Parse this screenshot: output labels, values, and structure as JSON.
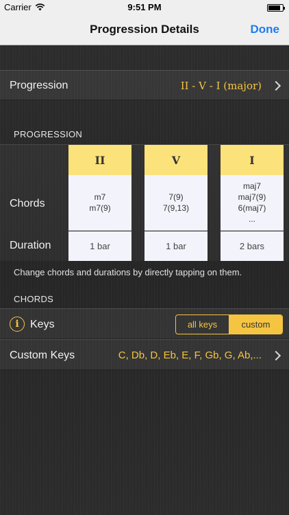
{
  "status_bar": {
    "carrier": "Carrier",
    "time": "9:51 PM",
    "battery_level": 0.85
  },
  "nav": {
    "title": "Progression Details",
    "done_label": "Done"
  },
  "progression_row": {
    "label": "Progression",
    "value": "II - V - I  (major)"
  },
  "progression_section": {
    "header": "PROGRESSION",
    "chords_label": "Chords",
    "duration_label": "Duration",
    "columns": [
      {
        "numeral": "II",
        "chords": [
          "m7",
          "m7(9)"
        ],
        "duration": "1 bar"
      },
      {
        "numeral": "V",
        "chords": [
          "7(9)",
          "7(9,13)"
        ],
        "duration": "1 bar"
      },
      {
        "numeral": "I",
        "chords": [
          "maj7",
          "maj7(9)",
          "6(maj7)",
          "..."
        ],
        "duration": "2 bars"
      }
    ],
    "footnote": "Change chords and durations by directly tapping on them."
  },
  "chords_section": {
    "header": "CHORDS",
    "keys_label": "Keys",
    "segments": [
      {
        "label": "all keys",
        "selected": false
      },
      {
        "label": "custom",
        "selected": true
      }
    ],
    "custom_keys_label": "Custom Keys",
    "custom_keys_value": "C, Db, D, Eb, E, F, Gb, G, Ab,..."
  },
  "colors": {
    "accent": "#f5c542",
    "link": "#1d7cf2",
    "header_cell": "#fce27a",
    "cell": "#f3f4fb"
  }
}
